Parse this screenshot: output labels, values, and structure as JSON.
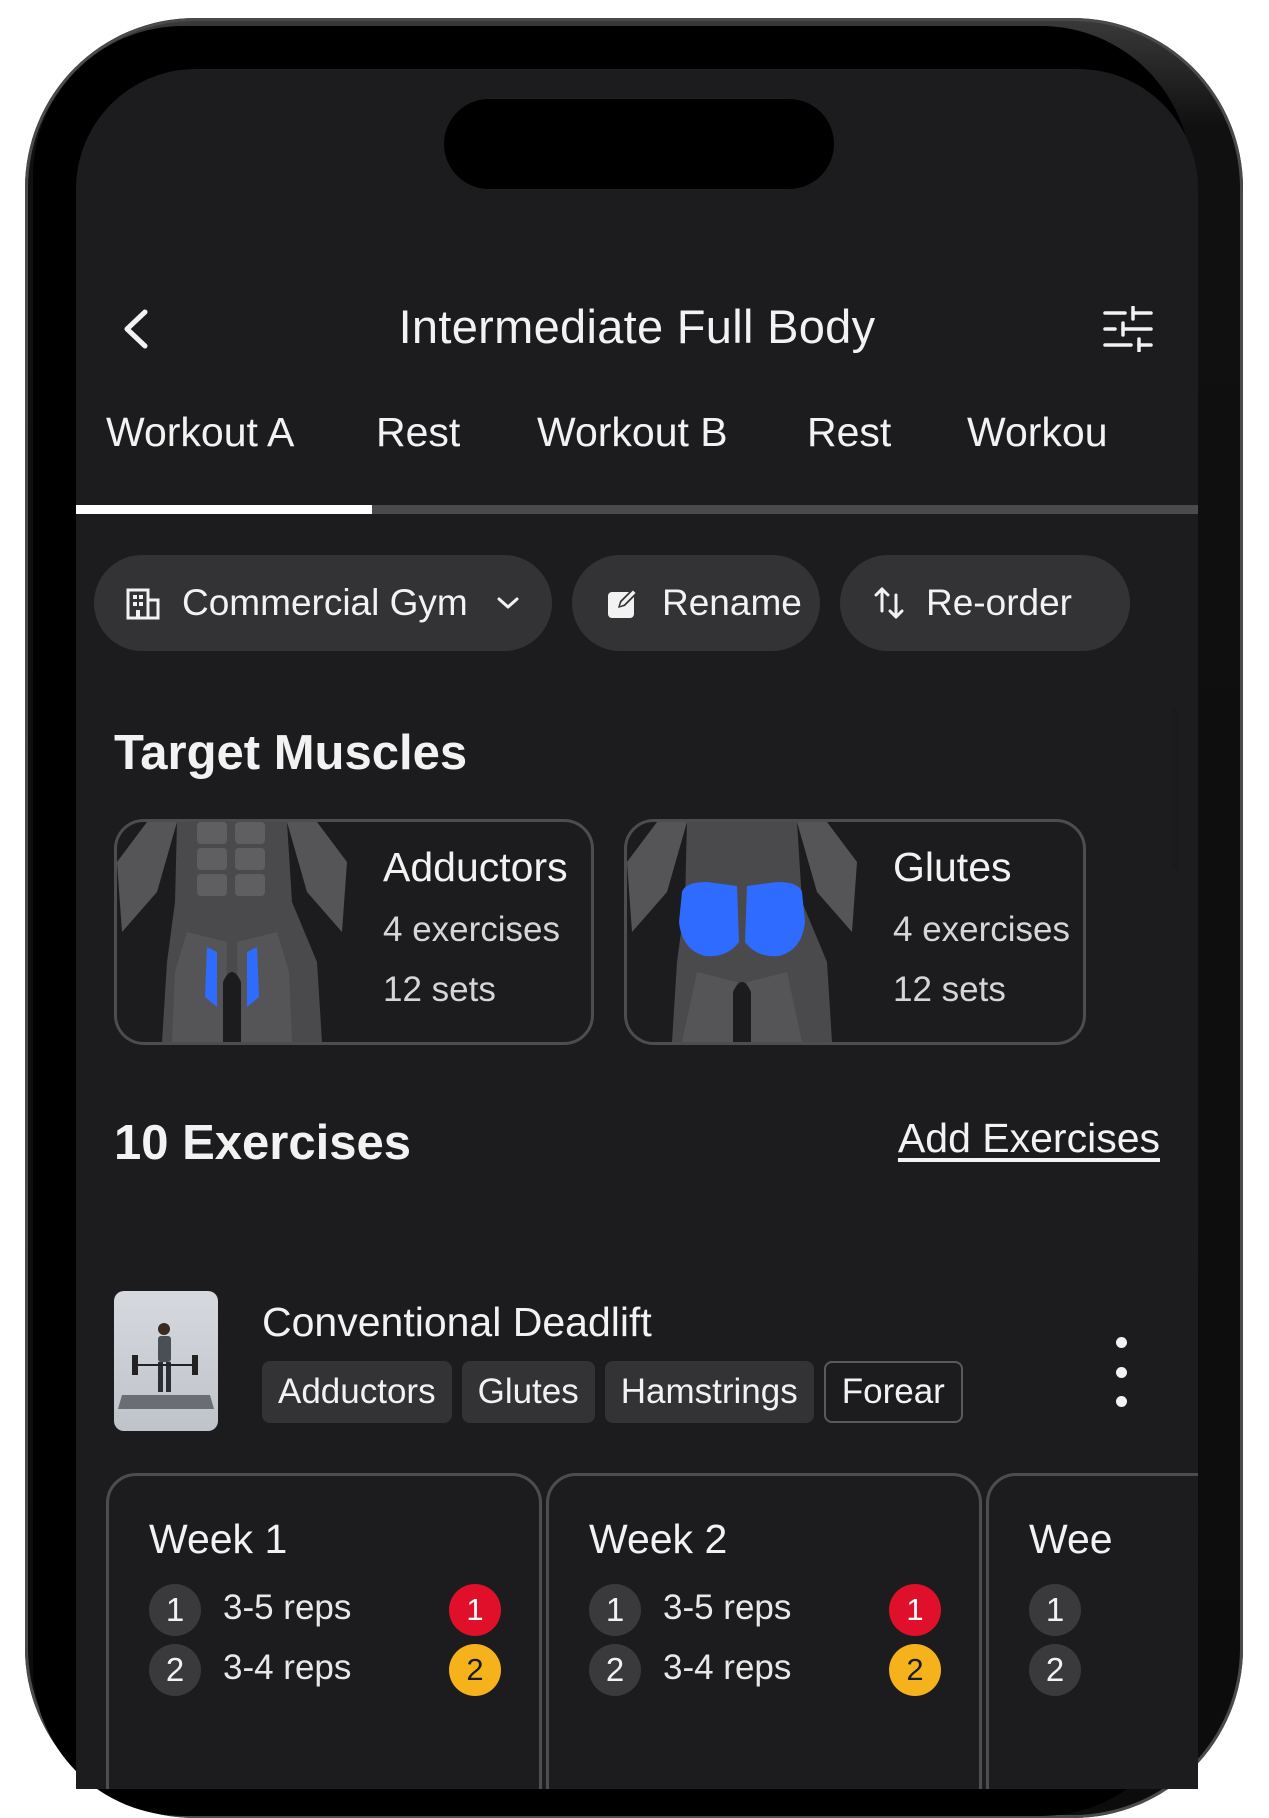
{
  "header": {
    "title": "Intermediate Full Body"
  },
  "tabs": [
    {
      "label": "Workout A"
    },
    {
      "label": "Rest"
    },
    {
      "label": "Workout B"
    },
    {
      "label": "Rest"
    },
    {
      "label": "Workou"
    }
  ],
  "actions": {
    "gym": "Commercial Gym",
    "rename": "Rename",
    "reorder": "Re-order"
  },
  "target_muscles": {
    "title": "Target Muscles",
    "cards": [
      {
        "name": "Adductors",
        "exercises": "4 exercises",
        "sets": "12 sets"
      },
      {
        "name": "Glutes",
        "exercises": "4 exercises",
        "sets": "12 sets"
      }
    ]
  },
  "exercises": {
    "title": "10 Exercises",
    "add_link": "Add Exercises",
    "items": [
      {
        "name": "Conventional Deadlift",
        "tags": [
          "Adductors",
          "Glutes",
          "Hamstrings",
          "Forear"
        ]
      }
    ]
  },
  "weeks": [
    {
      "title": "Week 1",
      "sets": [
        {
          "n": "1",
          "reps": "3-5 reps",
          "rpe": "1"
        },
        {
          "n": "2",
          "reps": "3-4 reps",
          "rpe": "2"
        }
      ]
    },
    {
      "title": "Week 2",
      "sets": [
        {
          "n": "1",
          "reps": "3-5 reps",
          "rpe": "1"
        },
        {
          "n": "2",
          "reps": "3-4 reps",
          "rpe": "2"
        }
      ]
    },
    {
      "title": "Wee",
      "sets": [
        {
          "n": "1"
        },
        {
          "n": "2"
        }
      ]
    }
  ],
  "colors": {
    "background": "#1c1c1e",
    "chip": "#333335",
    "muscle_highlight": "#2f6bff",
    "rpe_red": "#e0102a",
    "rpe_yellow": "#f6b21b"
  },
  "icons": [
    "back-icon",
    "sliders-icon",
    "building-icon",
    "chevron-down-icon",
    "edit-icon",
    "reorder-icon",
    "more-icon"
  ]
}
